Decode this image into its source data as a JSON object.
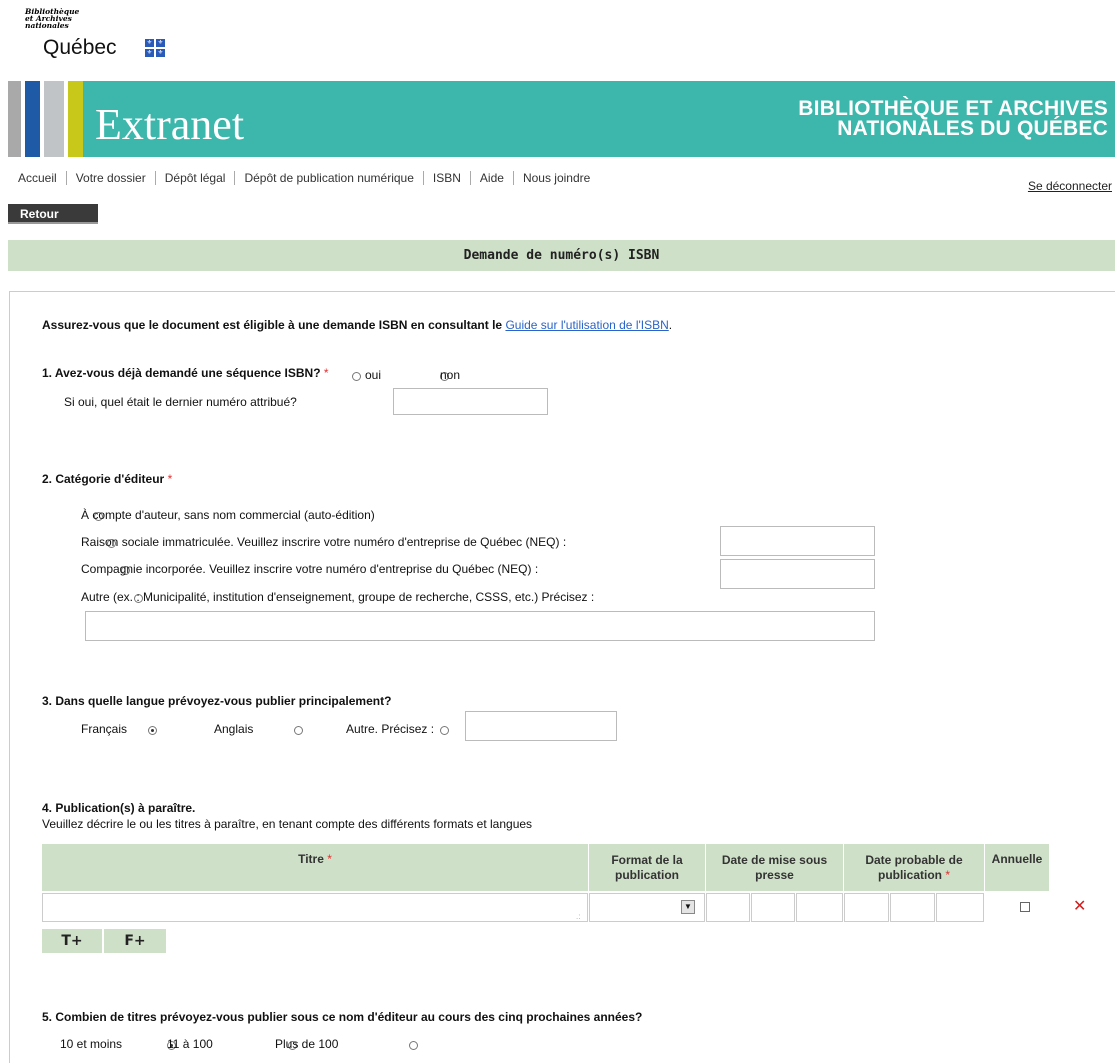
{
  "logo": {
    "line1": "Bibliothèque",
    "line2": "et Archives",
    "line3": "nationales",
    "wordmark": "Québec",
    "flag_icon": "fleur-de-lis-icon"
  },
  "banner": {
    "title": "Extranet",
    "org_line1": "BIBLIOTHÈQUE ET ARCHIVES",
    "org_line2": "NATIONALES DU QUÉBEC",
    "colors": {
      "teal": "#3db7ac",
      "stripe_gray": "#a9a9a9",
      "stripe_blue": "#1f5aa6",
      "stripe_light": "#c0c4c7",
      "stripe_yellow": "#c8c81a"
    }
  },
  "nav": {
    "items": [
      "Accueil",
      "Votre dossier",
      "Dépôt légal",
      "Dépôt de publication numérique",
      "ISBN",
      "Aide",
      "Nous joindre"
    ],
    "logout": "Se déconnecter"
  },
  "back_button": "Retour",
  "section_title": "Demande de numéro(s) ISBN",
  "intro": {
    "text": "Assurez-vous que le document est éligible à une demande ISBN en consultant le",
    "link": "Guide sur l'utilisation de l'ISBN",
    "end": "."
  },
  "q1": {
    "label": "1. Avez-vous déjà demandé une séquence ISBN?",
    "required": "*",
    "options": [
      "oui",
      "non"
    ],
    "sub_label": "Si oui, quel était le dernier numéro attribué?",
    "sub_value": ""
  },
  "q2": {
    "label": "2. Catégorie d'éditeur",
    "required": "*",
    "options": [
      "À compte d'auteur, sans nom commercial (auto-édition)",
      "Raison sociale immatriculée. Veuillez inscrire votre numéro d'entreprise de Québec (NEQ) :",
      "Compagnie incorporée. Veuillez inscrire votre numéro d'entreprise du Québec (NEQ) :",
      "Autre (ex. : Municipalité, institution d'enseignement, groupe de recherche, CSSS, etc.) Précisez :"
    ]
  },
  "q3": {
    "label": "3. Dans quelle langue prévoyez-vous publier principalement?",
    "options": [
      "Français",
      "Anglais",
      "Autre. Précisez :"
    ],
    "selected": "Français"
  },
  "q4": {
    "label": "4. Publication(s) à paraître.",
    "description": "Veuillez décrire le ou les titres à paraître, en tenant compte des différents formats et langues",
    "columns": {
      "title": "Titre",
      "title_req": "*",
      "format_1": "Format de la",
      "format_2": "publication",
      "press_1": "Date de mise sous",
      "press_2": "presse",
      "pub_1": "Date probable de",
      "pub_2": "publication",
      "pub_req": "*",
      "annual": "Annuelle"
    },
    "add_title_button": "T+",
    "add_format_button": "F+"
  },
  "q5": {
    "label": "5. Combien de titres prévoyez-vous publier sous ce nom d'éditeur au cours des cinq prochaines années?",
    "options": [
      "10 et moins",
      "11 à 100",
      "Plus de 100"
    ],
    "selected": "10 et moins"
  }
}
